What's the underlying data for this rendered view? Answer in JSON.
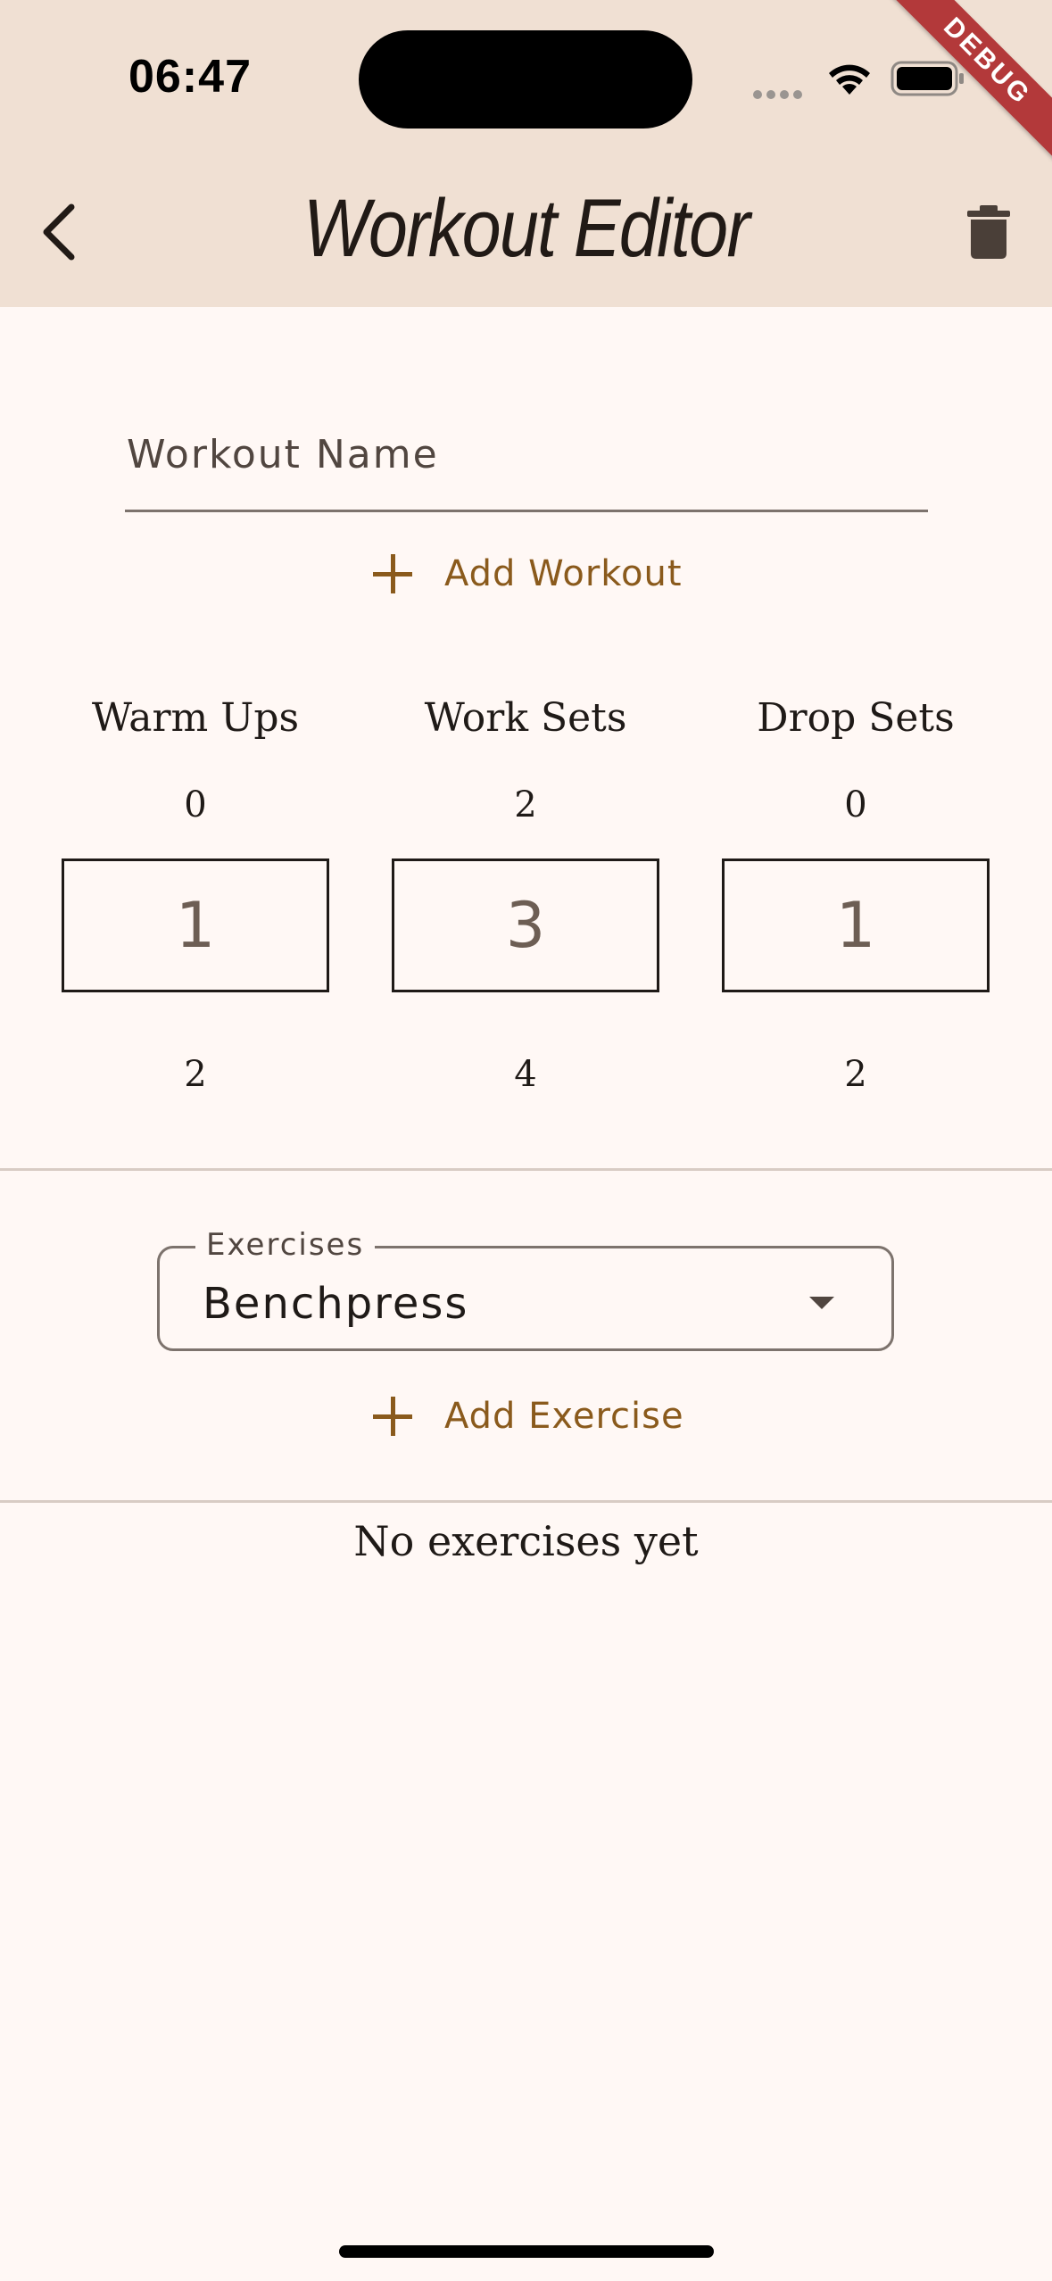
{
  "status_bar": {
    "time": "06:47"
  },
  "debug_banner": "DEBUG",
  "app_bar": {
    "title": "Workout Editor"
  },
  "workout_name": {
    "placeholder": "Workout Name",
    "value": ""
  },
  "add_workout_label": "Add Workout",
  "sets": [
    {
      "label": "Warm Ups",
      "prev": "0",
      "value": "1",
      "next": "2"
    },
    {
      "label": "Work Sets",
      "prev": "2",
      "value": "3",
      "next": "4"
    },
    {
      "label": "Drop Sets",
      "prev": "0",
      "value": "1",
      "next": "2"
    }
  ],
  "exercise_dropdown": {
    "label": "Exercises",
    "selected": "Benchpress"
  },
  "add_exercise_label": "Add Exercise",
  "empty_message": "No exercises yet",
  "colors": {
    "app_bar_bg": "#f0e0d3",
    "page_bg": "#fff8f5",
    "accent": "#8a5a1c",
    "debug_ribbon": "#b3393a"
  }
}
